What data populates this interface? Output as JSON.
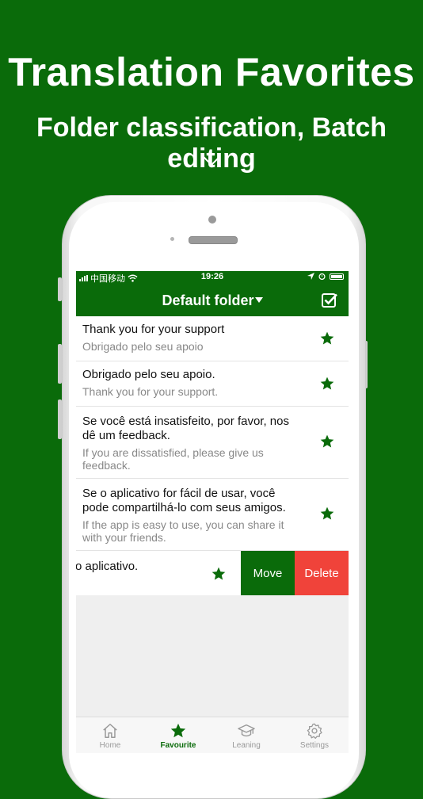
{
  "promo": {
    "title": "Translation Favorites",
    "subtitle": "Folder classification, Batch editing",
    "chevron_icon": "chevron-down-icon"
  },
  "status_bar": {
    "carrier": "中国移动",
    "time": "19:26"
  },
  "nav": {
    "title": "Default folder",
    "edit_icon": "checkbox-edit-icon"
  },
  "favorites": [
    {
      "source": "Thank you for your support",
      "translation": "Obrigado pelo seu apoio"
    },
    {
      "source": "Obrigado pelo seu apoio.",
      "translation": "Thank you for your support."
    },
    {
      "source": "Se você está insatisfeito, por favor, nos dê um feedback.",
      "translation": "If you are dissatisfied, please give us feedback."
    },
    {
      "source": "Se o aplicativo for fácil de usar, você pode compartilhá-lo com seus amigos.",
      "translation": "If the app is easy to use, you can share it with your friends."
    }
  ],
  "swiped_row": {
    "source": "o aplicativo.",
    "move_label": "Move",
    "delete_label": "Delete"
  },
  "tabs": [
    {
      "label": "Home",
      "icon": "home-icon"
    },
    {
      "label": "Favourite",
      "icon": "star-icon"
    },
    {
      "label": "Leaning",
      "icon": "graduation-cap-icon"
    },
    {
      "label": "Settings",
      "icon": "gear-icon"
    }
  ],
  "colors": {
    "brand_green": "#0a6b0a",
    "delete_red": "#f0433a"
  }
}
